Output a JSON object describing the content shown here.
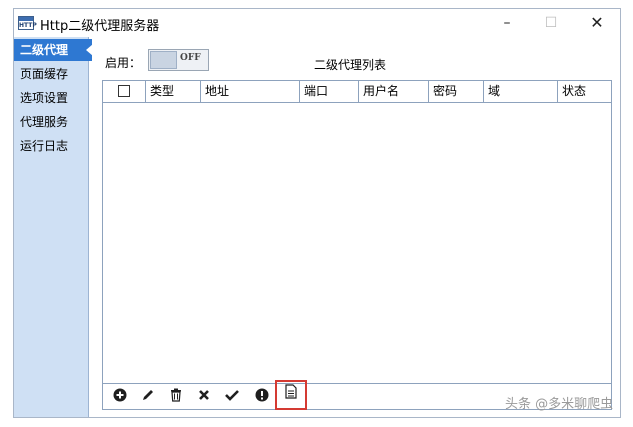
{
  "window": {
    "app_icon_text": "HTTP",
    "title": "Http二级代理服务器",
    "controls": {
      "minimize": "–",
      "maximize": "☐",
      "close": "✕"
    }
  },
  "sidebar": {
    "items": [
      {
        "label": "二级代理",
        "active": true
      },
      {
        "label": "页面缓存"
      },
      {
        "label": "选项设置"
      },
      {
        "label": "代理服务"
      },
      {
        "label": "运行日志"
      }
    ]
  },
  "main": {
    "enable_label": "启用：",
    "toggle_text": "OFF",
    "list_title": "二级代理列表",
    "table": {
      "columns": [
        "类型",
        "地址",
        "端口",
        "用户名",
        "密码",
        "域",
        "状态"
      ],
      "rows": []
    },
    "toolbar": {
      "add_icon": "add-circle-icon",
      "edit_icon": "pencil-icon",
      "delete_icon": "trash-icon",
      "remove_icon": "x-icon",
      "confirm_icon": "check-icon",
      "warning_icon": "exclamation-circle-icon",
      "doc_icon": "document-icon"
    },
    "highlight_color": "#d43a32"
  },
  "watermark": "头条 @多米聊爬虫"
}
